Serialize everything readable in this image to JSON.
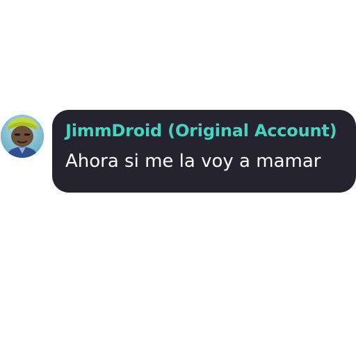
{
  "message": {
    "avatar_icon": "user-avatar-icon",
    "username": "JimmDroid (Original Account)",
    "text": "Ahora si me la voy a mamar"
  },
  "colors": {
    "bubble_background": "#25232f",
    "username": "#44d4c1",
    "message_text": "#ffffff"
  }
}
